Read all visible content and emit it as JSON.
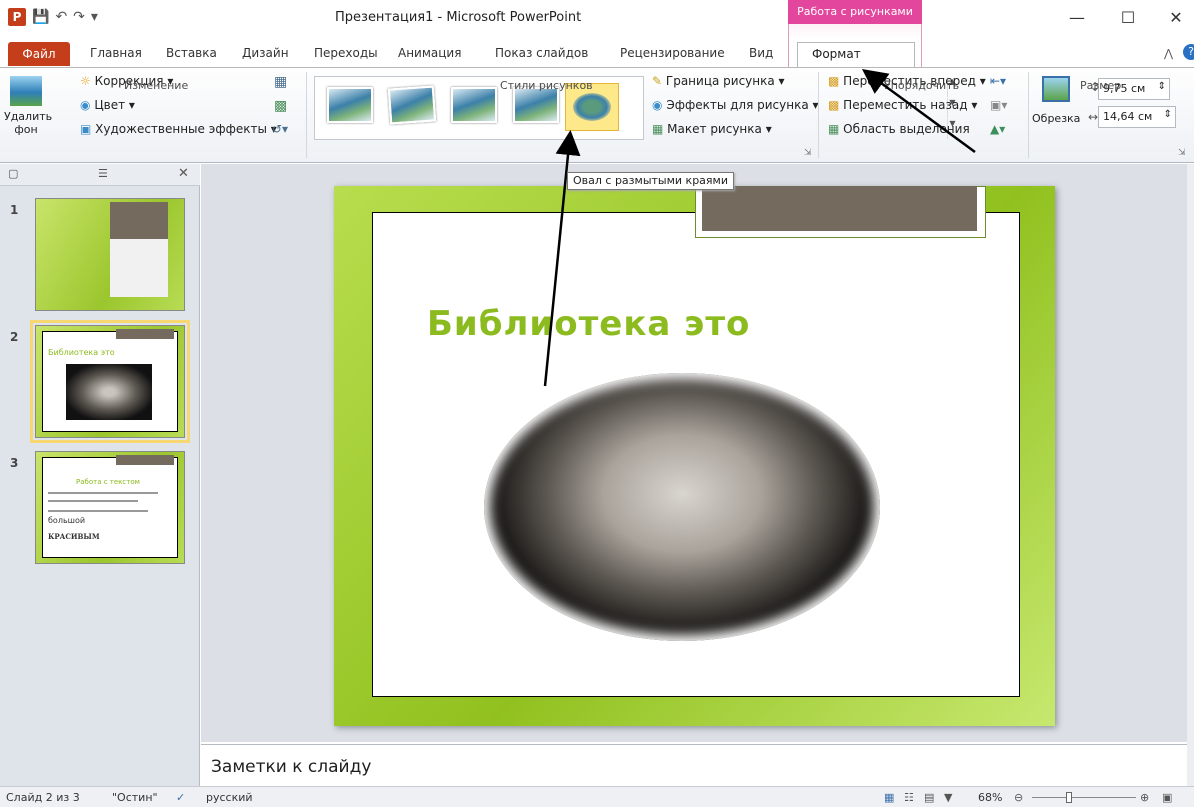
{
  "title_bar": {
    "app_title": "Презентация1 - Microsoft PowerPoint",
    "context_group": "Работа с рисунками",
    "app_logo": "P",
    "qat_icons": [
      "save-icon",
      "undo-icon",
      "redo-icon",
      "customize-icon"
    ]
  },
  "tabs": {
    "file": "Файл",
    "items": [
      "Главная",
      "Вставка",
      "Дизайн",
      "Переходы",
      "Анимация",
      "Показ слайдов",
      "Рецензирование",
      "Вид"
    ],
    "active": "Формат"
  },
  "ribbon": {
    "change_group": {
      "label": "Изменение",
      "remove_bg": "Удалить фон",
      "corrections": "Коррекция",
      "color": "Цвет",
      "art_effects": "Художественные эффекты"
    },
    "styles_group": {
      "label": "Стили рисунков",
      "border": "Граница рисунка",
      "effects": "Эффекты для рисунка",
      "layout": "Макет рисунка"
    },
    "arrange_group": {
      "label": "Упорядочить",
      "bring_forward": "Переместить вперед",
      "send_backward": "Переместить назад",
      "selection_pane": "Область выделения"
    },
    "size_group": {
      "label": "Размер",
      "crop": "Обрезка",
      "height": "9,75 см",
      "width": "14,64 см"
    }
  },
  "tooltip": "Овал с размытыми краями",
  "slides_panel": {
    "numbers": [
      "1",
      "2",
      "3"
    ],
    "thumb2_title": "Библиотека это",
    "thumb3_title": "Работа с текстом",
    "thumb3_big": "большой",
    "thumb3_caps": "КРАСИВЫМ"
  },
  "slide": {
    "title": "Библиотека это"
  },
  "notes": {
    "placeholder": "Заметки к слайду"
  },
  "status": {
    "slide_info": "Слайд 2 из 3",
    "theme": "\"Остин\"",
    "language": "русский",
    "zoom": "68%"
  },
  "colors": {
    "file_tab": "#c43e1c",
    "context_tab": "#e3479d",
    "slide_green": "#91c11f",
    "title_green": "#8cbb1f"
  }
}
